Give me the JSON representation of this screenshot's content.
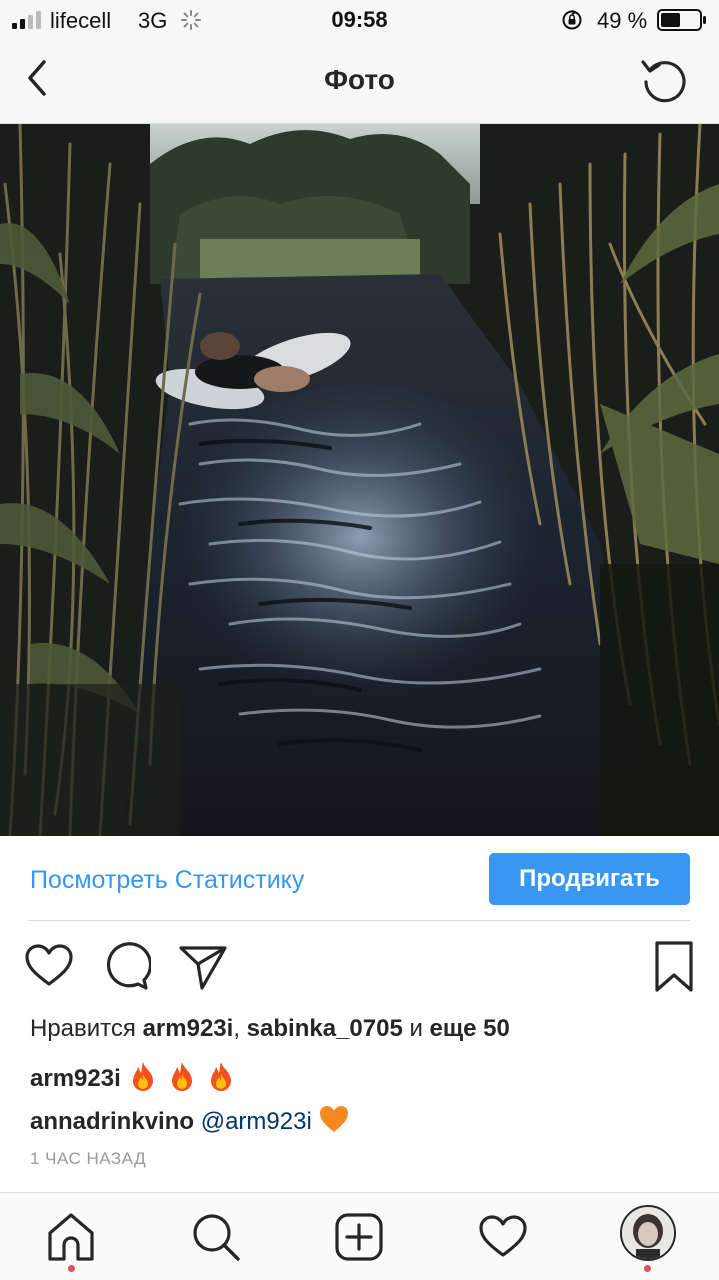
{
  "status_bar": {
    "carrier": "lifecell",
    "network": "3G",
    "time": "09:58",
    "battery": "49 %",
    "icons": [
      "signal-icon",
      "activity-spinner-icon",
      "rotation-lock-icon",
      "battery-icon"
    ]
  },
  "header": {
    "title": "Фото",
    "icons": [
      "back-chevron-icon",
      "refresh-icon"
    ]
  },
  "insights": {
    "view_stats": "Посмотреть Статистику",
    "promote": "Продвигать",
    "accent_color": "#3897f0"
  },
  "actions": {
    "icons": [
      "heart-icon",
      "comment-icon",
      "share-icon",
      "bookmark-icon"
    ]
  },
  "likes": {
    "prefix": "Нравится",
    "user1": "arm923i",
    "separator": ",",
    "user2": "sabinka_0705",
    "conjunction": "и",
    "others": "еще 50"
  },
  "comments": [
    {
      "username": "arm923i",
      "text": "",
      "emoji": [
        "fire",
        "fire",
        "fire"
      ]
    },
    {
      "username": "annadrinkvino",
      "mention": "@arm923i",
      "emoji": [
        "orange-heart"
      ]
    }
  ],
  "timestamp": "1 ЧАС НАЗАД",
  "tab_bar": {
    "items": [
      "home",
      "search",
      "create",
      "activity",
      "profile"
    ],
    "notification_color": "#ed4956"
  }
}
